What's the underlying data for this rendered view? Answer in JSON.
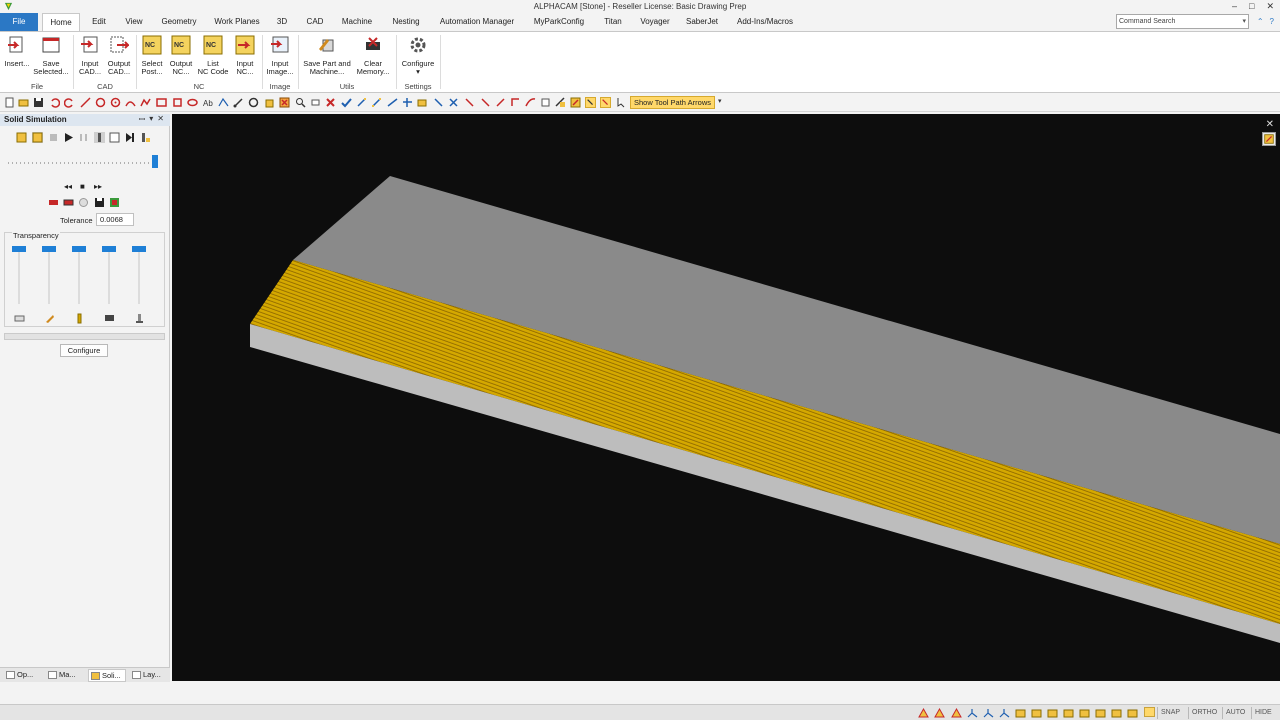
{
  "window": {
    "title": "ALPHACAM [Stone] - Reseller License: Basic Drawing Prep",
    "minimize": "–",
    "maximize": "□",
    "close": "✕"
  },
  "ribbon_tabs": [
    {
      "label": "File"
    },
    {
      "label": "Home"
    },
    {
      "label": "Edit"
    },
    {
      "label": "View"
    },
    {
      "label": "Geometry"
    },
    {
      "label": "Work Planes"
    },
    {
      "label": "3D"
    },
    {
      "label": "CAD"
    },
    {
      "label": "Machine"
    },
    {
      "label": "Nesting"
    },
    {
      "label": "Automation Manager"
    },
    {
      "label": "MyParkConfig"
    },
    {
      "label": "Titan"
    },
    {
      "label": "Voyager"
    },
    {
      "label": "SaberJet"
    },
    {
      "label": "Add-Ins/Macros"
    }
  ],
  "active_tab": "Home",
  "command_search": {
    "placeholder": "Command Search"
  },
  "help_buttons": {
    "up": "⌃",
    "help": "?"
  },
  "ribbon": {
    "buttons": {
      "insert": {
        "line1": "Insert...",
        "line2": ""
      },
      "save_selected": {
        "line1": "Save",
        "line2": "Selected..."
      },
      "input_cad": {
        "line1": "Input",
        "line2": "CAD..."
      },
      "output_cad": {
        "line1": "Output",
        "line2": "CAD..."
      },
      "select_post": {
        "line1": "Select",
        "line2": "Post..."
      },
      "output_nc": {
        "line1": "Output",
        "line2": "NC..."
      },
      "list_nc": {
        "line1": "List",
        "line2": "NC Code"
      },
      "input_nc": {
        "line1": "Input",
        "line2": "NC..."
      },
      "input_image": {
        "line1": "Input",
        "line2": "Image..."
      },
      "save_part": {
        "line1": "Save Part and",
        "line2": "Machine..."
      },
      "clear_memory": {
        "line1": "Clear",
        "line2": "Memory..."
      },
      "configure": {
        "line1": "Configure",
        "line2": "▾"
      }
    },
    "groups": {
      "file": "File",
      "cad": "CAD",
      "nc": "NC",
      "image": "Image",
      "utils": "Utils",
      "settings": "Settings"
    },
    "nc_icon_text": "NC"
  },
  "quick_toolbar": {
    "show_tool_path_arrows": "Show Tool Path Arrows",
    "dropdown": "▾"
  },
  "panel": {
    "title": "Solid Simulation",
    "header_buttons": {
      "pin": "ꟷ",
      "dropdown": "▾",
      "close": "✕"
    },
    "step_buttons": {
      "back": "◂◂",
      "stop": "■",
      "forward": "▸▸"
    },
    "tolerance_label": "Tolerance",
    "tolerance_value": "0.0068",
    "transparency_label": "Transparency",
    "position_fraction": 1.0,
    "configure_button": "Configure",
    "tabs": [
      {
        "label": "Op..."
      },
      {
        "label": "Ma..."
      },
      {
        "label": "Soli..."
      },
      {
        "label": "Lay..."
      }
    ]
  },
  "viewport": {
    "close": "✕",
    "background": "#0d0d0d",
    "part_top_color": "#8a8a8a",
    "part_side_color": "#bdbdbd",
    "toolpath_color": "#d4a800"
  },
  "status_bar": {
    "snap": "SNAP",
    "ortho": "ORTHO",
    "auto": "AUTO",
    "hide": "HIDE"
  }
}
